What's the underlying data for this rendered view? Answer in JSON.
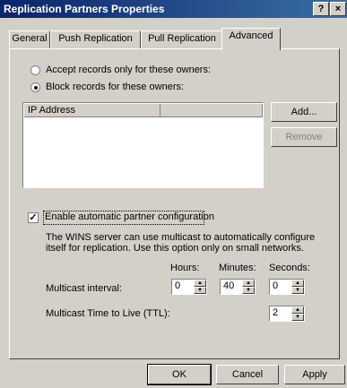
{
  "window": {
    "title": "Replication Partners Properties",
    "help_label": "?",
    "close_label": "×"
  },
  "tabs": [
    {
      "label": "General",
      "active": false
    },
    {
      "label": "Push Replication",
      "active": false
    },
    {
      "label": "Pull Replication",
      "active": false
    },
    {
      "label": "Advanced",
      "active": true
    }
  ],
  "records": {
    "accept_label": "Accept records only for these owners:",
    "block_label": "Block records for these owners:",
    "selected": "block",
    "column_header": "IP Address",
    "add_label": "Add...",
    "remove_label": "Remove"
  },
  "partner": {
    "checkbox_label": "Enable automatic partner configuration",
    "checked": true,
    "description": "The WINS server can use multicast to automatically configure itself for replication. Use this option only on small networks.",
    "hours_label": "Hours:",
    "minutes_label": "Minutes:",
    "seconds_label": "Seconds:",
    "interval_label": "Multicast interval:",
    "hours": "0",
    "minutes": "40",
    "seconds": "0",
    "ttl_label": "Multicast Time to Live (TTL):",
    "ttl": "2"
  },
  "footer": {
    "ok_label": "OK",
    "cancel_label": "Cancel",
    "apply_label": "Apply"
  }
}
